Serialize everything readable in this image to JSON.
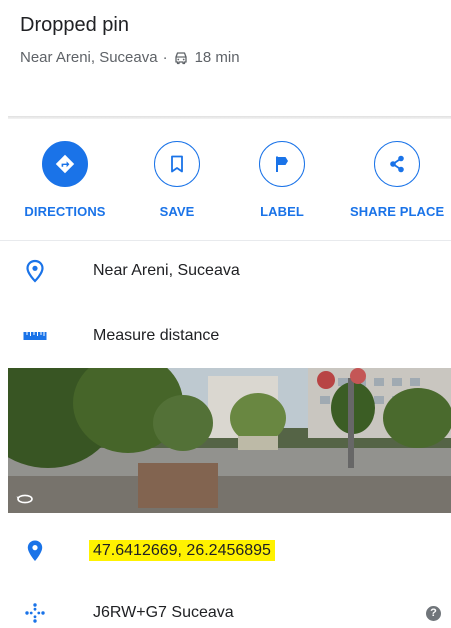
{
  "header": {
    "title": "Dropped pin",
    "location": "Near Areni, Suceava",
    "separator": "·",
    "drive_time": "18 min"
  },
  "actions": [
    {
      "label": "DIRECTIONS",
      "icon": "directions-icon"
    },
    {
      "label": "SAVE",
      "icon": "bookmark-icon"
    },
    {
      "label": "LABEL",
      "icon": "flag-icon"
    },
    {
      "label": "SHARE PLACE",
      "icon": "share-icon"
    }
  ],
  "rows": {
    "address": "Near Areni, Suceava",
    "measure": "Measure distance",
    "coordinates": "47.6412669, 26.2456895",
    "plus_code": "J6RW+G7 Suceava",
    "help": "?"
  },
  "colors": {
    "accent": "#1a73e8",
    "highlight": "#fff200",
    "text": "#202124",
    "secondary_text": "#5f6368"
  }
}
